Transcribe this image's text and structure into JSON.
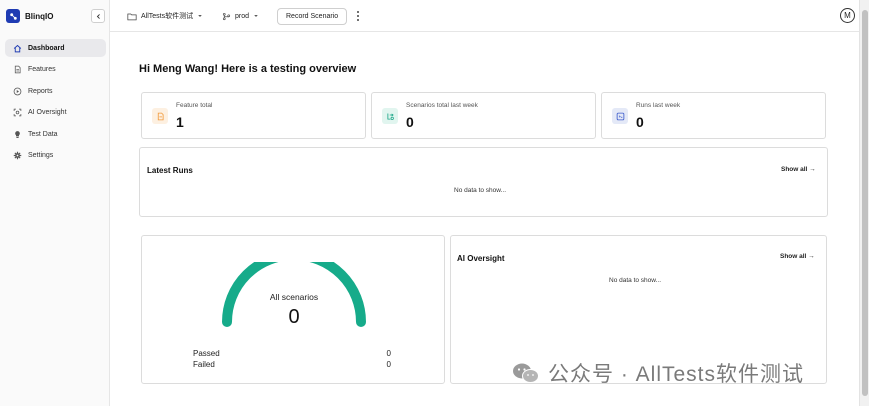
{
  "app": {
    "name": "BlinqIO"
  },
  "sidebar": {
    "items": [
      {
        "label": "Dashboard",
        "icon": "home-icon",
        "active": true
      },
      {
        "label": "Features",
        "icon": "document-icon"
      },
      {
        "label": "Reports",
        "icon": "play-circle-icon"
      },
      {
        "label": "AI Oversight",
        "icon": "ai-oversight-icon"
      },
      {
        "label": "Test Data",
        "icon": "lightbulb-icon"
      },
      {
        "label": "Settings",
        "icon": "gear-icon"
      }
    ]
  },
  "topbar": {
    "project": "AllTests软件测试",
    "environment": "prod",
    "record_label": "Record Scenario",
    "avatar_initial": "M"
  },
  "main": {
    "greeting": "Hi Meng Wang! Here is a testing overview",
    "stats": [
      {
        "label": "Feature total",
        "value": "1",
        "icon": "feature-icon",
        "color": "#f29a3a",
        "bg": "#fdf0e1"
      },
      {
        "label": "Scenarios total last week",
        "value": "0",
        "icon": "scenarios-icon",
        "color": "#19a587",
        "bg": "#e1f5ef"
      },
      {
        "label": "Runs last week",
        "value": "0",
        "icon": "runs-icon",
        "color": "#3b5bcc",
        "bg": "#e4e9f7"
      }
    ],
    "latest_runs": {
      "title": "Latest Runs",
      "show_all": "Show all →",
      "empty": "No data to show..."
    },
    "scenarios": {
      "label": "All scenarios",
      "total": "0",
      "passed_label": "Passed",
      "passed_value": "0",
      "failed_label": "Failed",
      "failed_value": "0",
      "gauge_color": "#16ab8a"
    },
    "ai_oversight": {
      "title": "AI Oversight",
      "show_all": "Show all →",
      "empty": "No data to show..."
    }
  },
  "watermark": {
    "text": "公众号 · AllTests软件测试"
  }
}
